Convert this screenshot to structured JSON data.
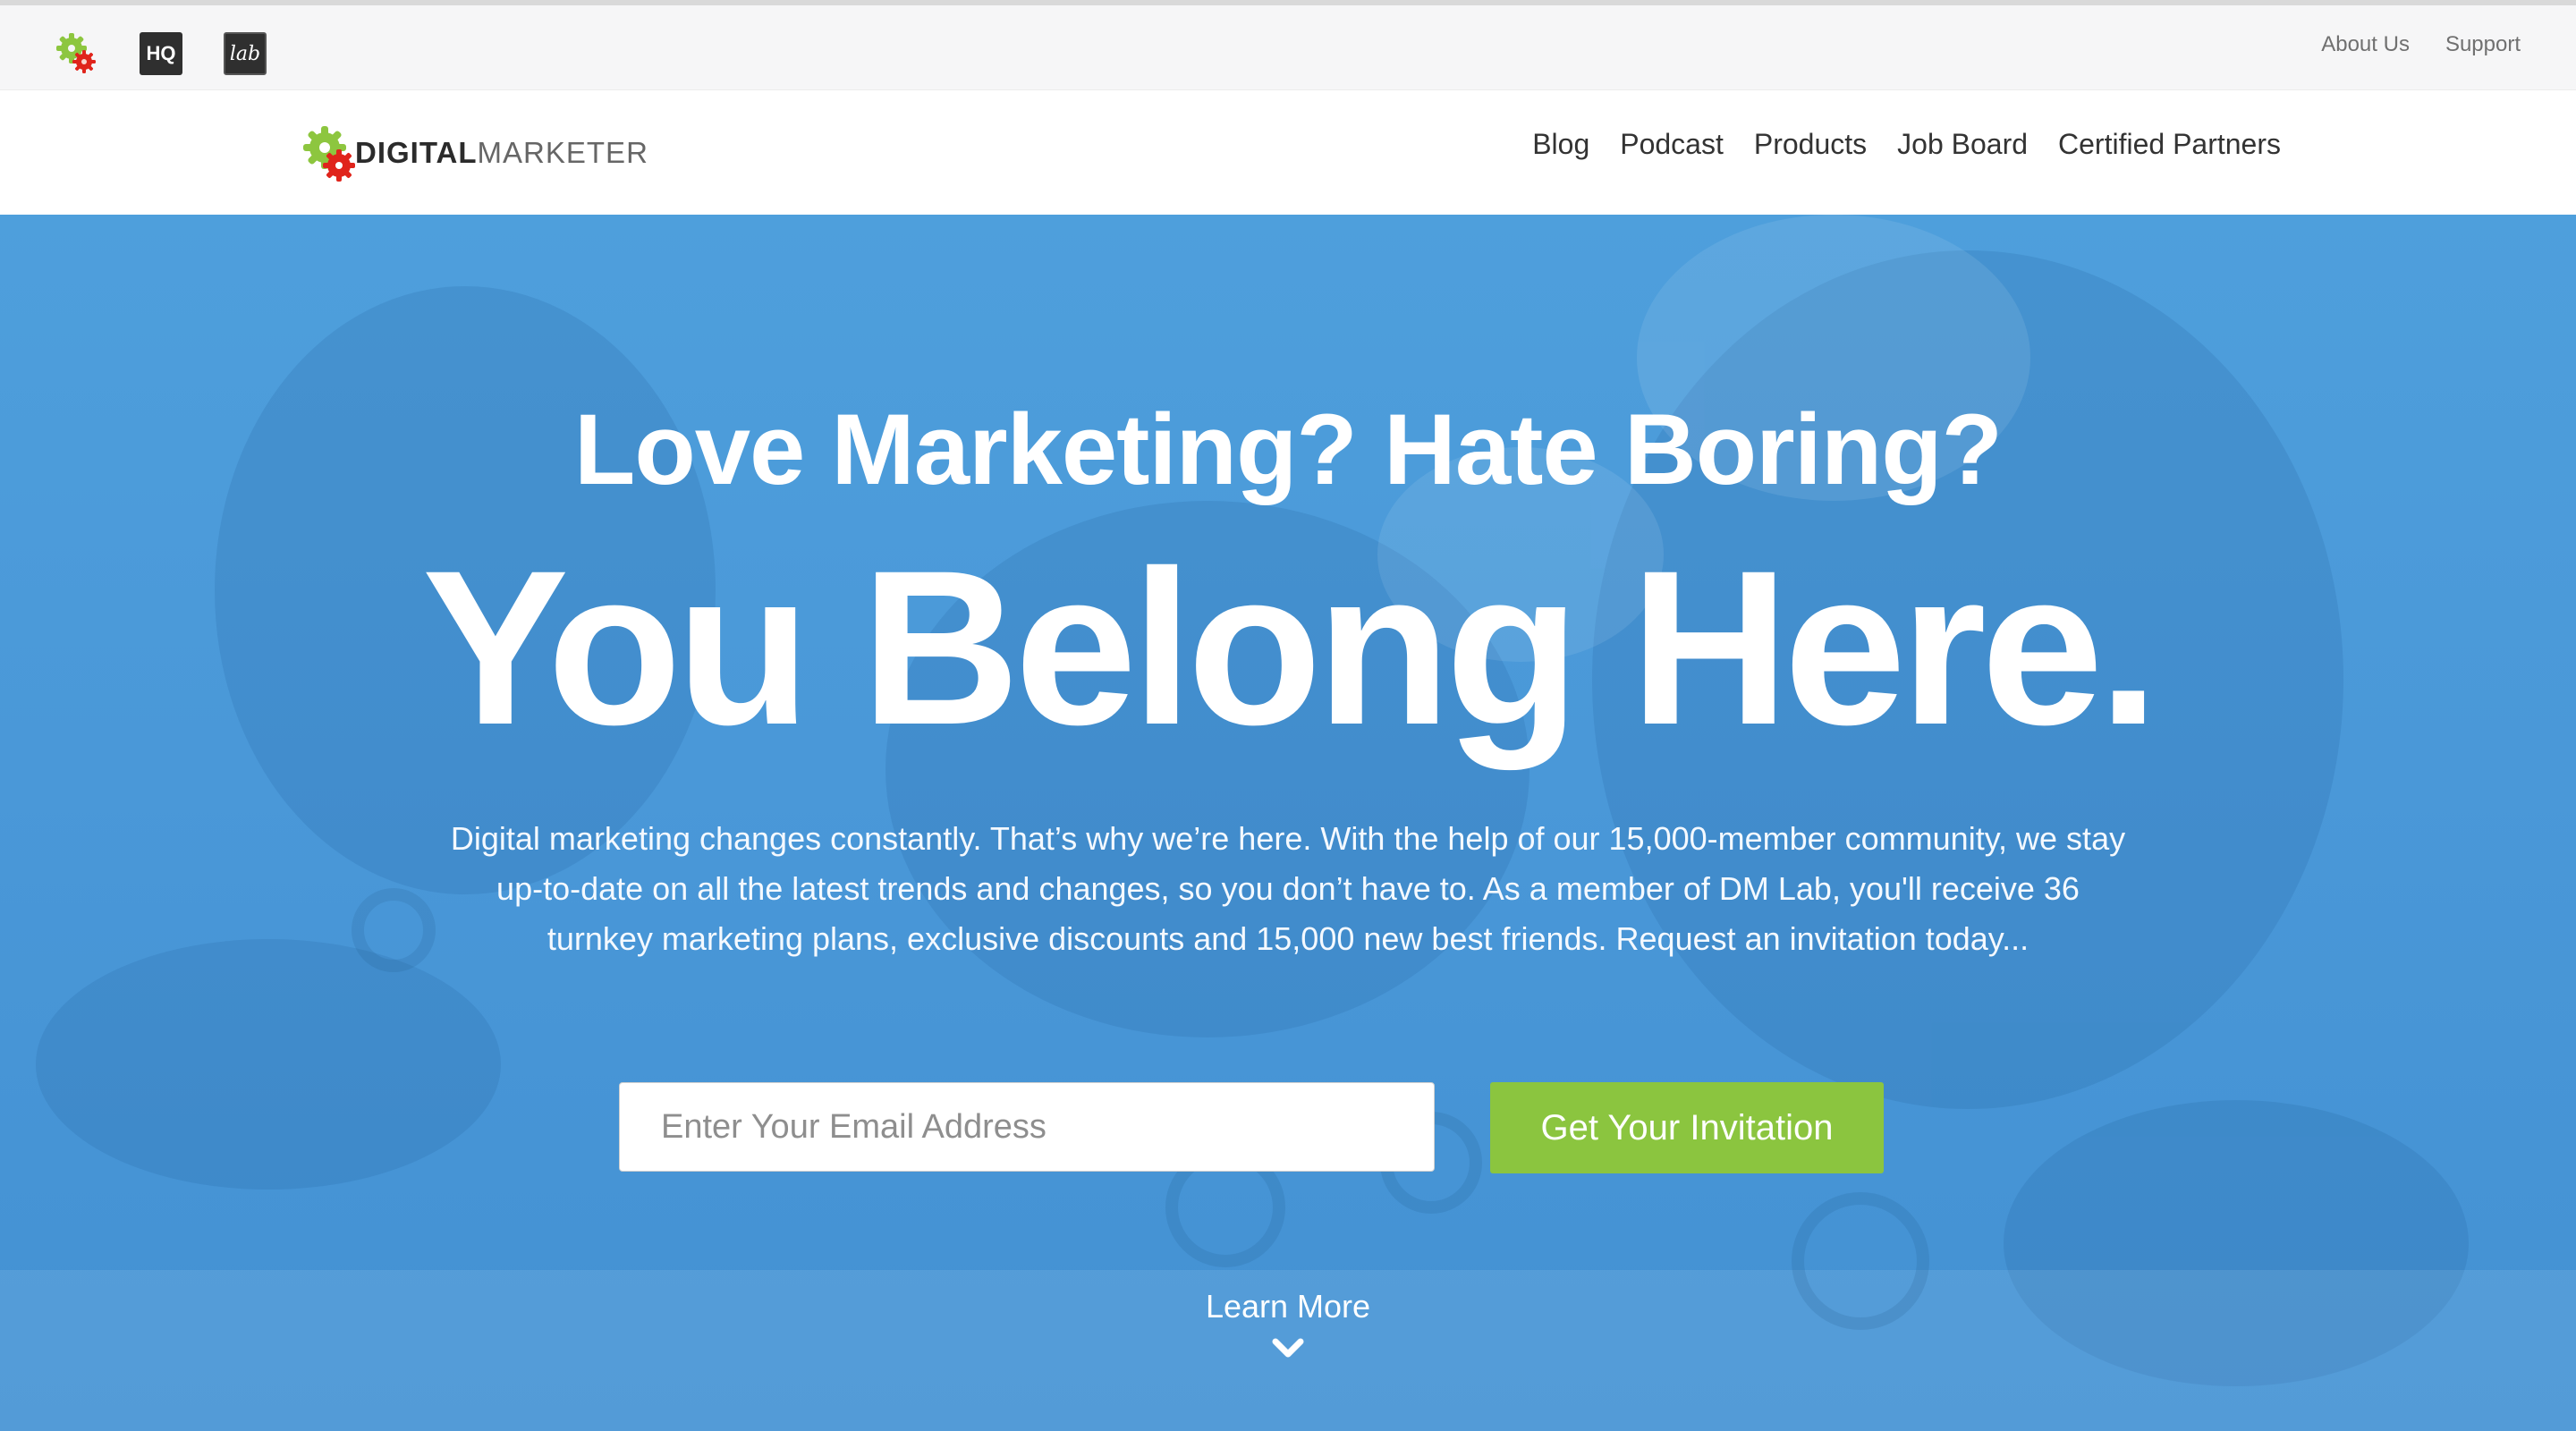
{
  "utility_bar": {
    "icons": [
      "digitalmarketer-gear-icon",
      "hq-icon",
      "lab-icon"
    ],
    "hq_label": "HQ",
    "lab_label": "lab",
    "links": [
      "About Us",
      "Support"
    ]
  },
  "nav": {
    "logo_bold": "DIGITAL",
    "logo_light": "MARKETER",
    "items": [
      "Blog",
      "Podcast",
      "Products",
      "Job Board",
      "Certified Partners"
    ]
  },
  "hero": {
    "subtitle": "Love Marketing? Hate Boring?",
    "title": "You Belong Here.",
    "description": "Digital marketing changes constantly. That’s why we’re here. With the help of our 15,000-member community, we stay up-to-date on all the latest trends and changes, so you don’t have to. As a member of DM Lab, you'll receive 36 turnkey marketing plans, exclusive discounts and 15,000 new best friends. Request an invitation today...",
    "email_placeholder": "Enter Your Email Address",
    "cta_label": "Get Your Invitation",
    "learn_more": "Learn More"
  },
  "colors": {
    "hero_blue": "#4a98d8",
    "cta_green": "#8bc53f",
    "gear_green": "#8dc63f",
    "gear_red": "#e0241b"
  }
}
